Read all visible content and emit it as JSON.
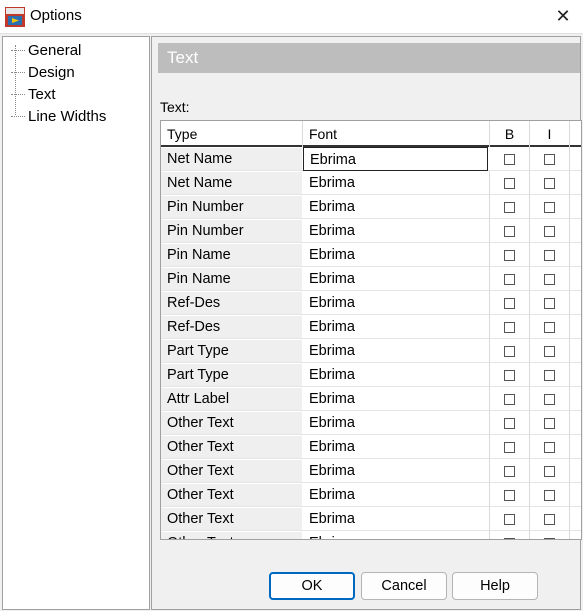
{
  "window": {
    "title": "Options",
    "icon": "pads-app-icon",
    "close_label": "✕"
  },
  "tree": {
    "items": [
      {
        "label": "General"
      },
      {
        "label": "Design"
      },
      {
        "label": "Text"
      },
      {
        "label": "Line Widths"
      }
    ]
  },
  "panel": {
    "header": "Text",
    "grid_label": "Text:",
    "columns": {
      "type": "Type",
      "font": "Font",
      "bold": "B",
      "italic": "I"
    },
    "rows": [
      {
        "type": "Net Name",
        "font": "Ebrima",
        "bold": false,
        "italic": false
      },
      {
        "type": "Net Name",
        "font": "Ebrima",
        "bold": false,
        "italic": false
      },
      {
        "type": "Pin Number",
        "font": "Ebrima",
        "bold": false,
        "italic": false
      },
      {
        "type": "Pin Number",
        "font": "Ebrima",
        "bold": false,
        "italic": false
      },
      {
        "type": "Pin Name",
        "font": "Ebrima",
        "bold": false,
        "italic": false
      },
      {
        "type": "Pin Name",
        "font": "Ebrima",
        "bold": false,
        "italic": false
      },
      {
        "type": "Ref-Des",
        "font": "Ebrima",
        "bold": false,
        "italic": false
      },
      {
        "type": "Ref-Des",
        "font": "Ebrima",
        "bold": false,
        "italic": false
      },
      {
        "type": "Part Type",
        "font": "Ebrima",
        "bold": false,
        "italic": false
      },
      {
        "type": "Part Type",
        "font": "Ebrima",
        "bold": false,
        "italic": false
      },
      {
        "type": "Attr Label",
        "font": "Ebrima",
        "bold": false,
        "italic": false
      },
      {
        "type": "Other Text",
        "font": "Ebrima",
        "bold": false,
        "italic": false
      },
      {
        "type": "Other Text",
        "font": "Ebrima",
        "bold": false,
        "italic": false
      },
      {
        "type": "Other Text",
        "font": "Ebrima",
        "bold": false,
        "italic": false
      },
      {
        "type": "Other Text",
        "font": "Ebrima",
        "bold": false,
        "italic": false
      },
      {
        "type": "Other Text",
        "font": "Ebrima",
        "bold": false,
        "italic": false
      },
      {
        "type": "Other Text",
        "font": "Ebrima",
        "bold": false,
        "italic": false
      }
    ]
  },
  "buttons": {
    "ok": "OK",
    "cancel": "Cancel",
    "help": "Help"
  }
}
